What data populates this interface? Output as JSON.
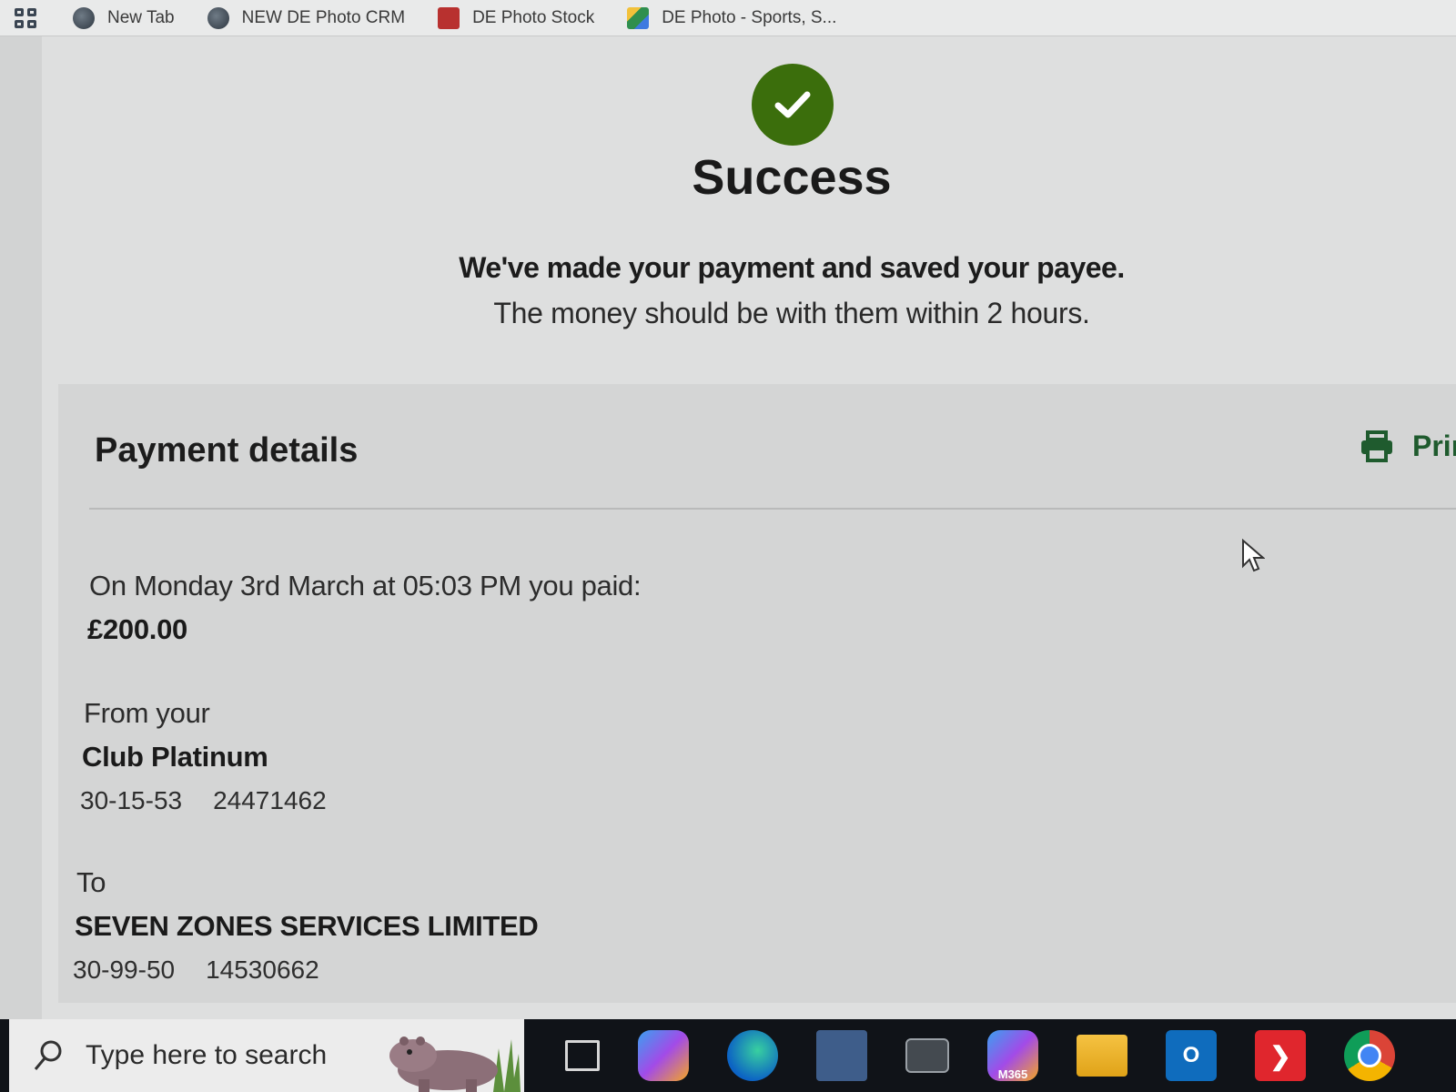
{
  "bookmarks": [
    {
      "label": "New Tab",
      "icon": "globe-icon"
    },
    {
      "label": "NEW DE Photo CRM",
      "icon": "globe-icon"
    },
    {
      "label": "DE Photo Stock",
      "icon": "stock-icon"
    },
    {
      "label": "DE Photo - Sports, S...",
      "icon": "drive-icon"
    }
  ],
  "confirmation": {
    "title": "Success",
    "message": "We've made your payment and saved your payee.",
    "submessage": "The money should be with them within 2 hours.",
    "accent_color": "#3b6e0c"
  },
  "payment_details": {
    "heading": "Payment details",
    "print_label": "Print",
    "paid_line": "On Monday 3rd March at 05:03 PM you paid:",
    "amount": "£200.00",
    "from_label": "From your",
    "from_account_name": "Club Platinum",
    "from_sort_code": "30-15-53",
    "from_account_number": "24471462",
    "to_label": "To",
    "to_payee_name": "SEVEN ZONES SERVICES LIMITED",
    "to_sort_code": "30-99-50",
    "to_account_number": "14530662",
    "print_color": "#1f5b2e"
  },
  "taskbar": {
    "search_placeholder": "Type here to search",
    "m365_label": "M365",
    "outlook_letter": "O",
    "chrome_profile": "C"
  }
}
